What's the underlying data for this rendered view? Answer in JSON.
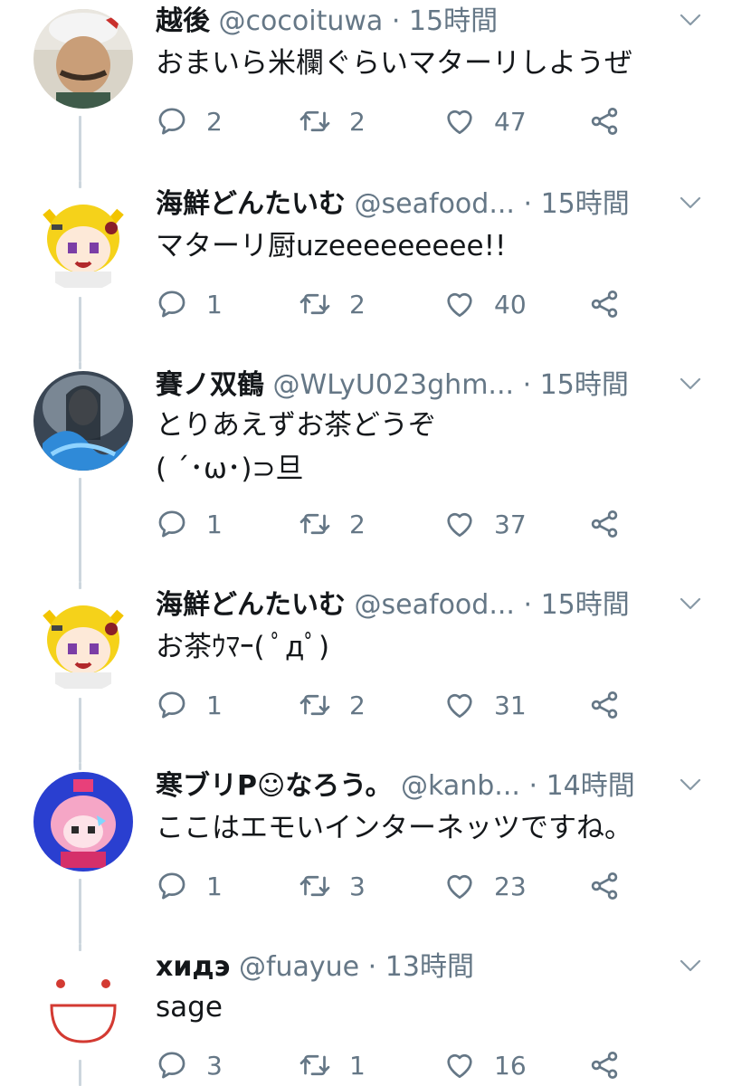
{
  "tweets": [
    {
      "name": "越後",
      "handle": "@cocoituwa",
      "sep": "·",
      "time": "15時間",
      "text": "おまいら米欄ぐらいマターリしようぜ",
      "replies": "2",
      "retweets": "2",
      "likes": "47"
    },
    {
      "name": "海鮮どんたいむ",
      "handle": "@seafood...",
      "sep": "·",
      "time": "15時間",
      "text": "マターリ厨uzeeeeeeeee!!",
      "replies": "1",
      "retweets": "2",
      "likes": "40"
    },
    {
      "name": "賽ノ双鶴",
      "handle": "@WLyU023ghm...",
      "sep": "·",
      "time": "15時間",
      "text": "とりあえずお茶どうぞ\n( ´･ω･)⊃旦",
      "replies": "1",
      "retweets": "2",
      "likes": "37"
    },
    {
      "name": "海鮮どんたいむ",
      "handle": "@seafood...",
      "sep": "·",
      "time": "15時間",
      "text": "お茶ｳﾏｰ( ﾟдﾟ)",
      "replies": "1",
      "retweets": "2",
      "likes": "31"
    },
    {
      "name": "寒ブリP☺なろう。",
      "handle": "@kanb...",
      "sep": "·",
      "time": "14時間",
      "text": "ここはエモいインターネッツですね。",
      "replies": "1",
      "retweets": "3",
      "likes": "23"
    },
    {
      "name": "хидэ",
      "handle": "@fuayue",
      "sep": "·",
      "time": "13時間",
      "text": "sage",
      "replies": "3",
      "retweets": "1",
      "likes": "16"
    }
  ],
  "icons": {
    "reply": "reply-icon",
    "retweet": "retweet-icon",
    "like": "like-icon",
    "share": "share-icon",
    "more": "chevron-down-icon"
  }
}
